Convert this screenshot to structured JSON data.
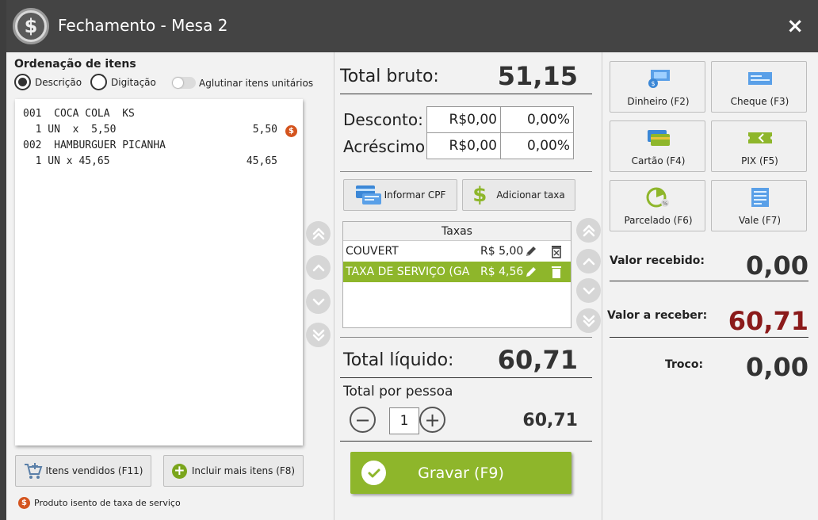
{
  "window": {
    "title": "Fechamento - Mesa 2",
    "close_label": "×",
    "icon": "dollar-coin-icon"
  },
  "ordering": {
    "title": "Ordenação de itens",
    "options": [
      {
        "label": "Descrição",
        "selected": true
      },
      {
        "label": "Digitação",
        "selected": false
      }
    ],
    "toggle_label": "Aglutinar itens unitários",
    "toggle_on": false
  },
  "receipt": {
    "items": [
      {
        "line1": "001  COCA COLA  KS",
        "line2": "  1 UN  x  5,50",
        "amount": "5,50",
        "exempt": true
      },
      {
        "line1": "002  HAMBURGUER PICANHA",
        "line2": "  1 UN x 45,65",
        "amount": "45,65",
        "exempt": false
      }
    ],
    "exempt_glyph": "$"
  },
  "left_buttons": {
    "sold_items": "Itens vendidos (F11)",
    "include_more": "Incluir mais itens (F8)"
  },
  "legend": {
    "text": "Produto isento de taxa de serviço"
  },
  "totals": {
    "gross_label": "Total bruto:",
    "gross_value": "51,15",
    "discount_label": "Desconto:",
    "discount_amount": "R$0,00",
    "discount_percent": "0,00%",
    "addition_label": "Acréscimo:",
    "addition_amount": "R$0,00",
    "addition_percent": "0,00%",
    "net_label": "Total líquido:",
    "net_value": "60,71",
    "per_person_label": "Total por pessoa",
    "people": "1",
    "per_person_value": "60,71"
  },
  "actions": {
    "cpf": "Informar CPF",
    "add_fee": "Adicionar taxa",
    "save": "Gravar (F9)"
  },
  "fees": {
    "header": "Taxas",
    "rows": [
      {
        "name": "COUVERT",
        "value": "R$ 5,00",
        "selected": false
      },
      {
        "name": "TAXA DE SERVIÇO (GA",
        "value": "R$ 4,56",
        "selected": true
      }
    ]
  },
  "payments": [
    {
      "label": "Dinheiro (F2)",
      "icon": "cash-icon"
    },
    {
      "label": "Cheque (F3)",
      "icon": "check-icon"
    },
    {
      "label": "Cartão (F4)",
      "icon": "card-icon"
    },
    {
      "label": "PIX (F5)",
      "icon": "pix-icon"
    },
    {
      "label": "Parcelado (F6)",
      "icon": "installments-icon"
    },
    {
      "label": "Vale (F7)",
      "icon": "voucher-icon"
    }
  ],
  "summary": {
    "received_label": "Valor recebido:",
    "received_value": "0,00",
    "to_receive_label": "Valor a receber:",
    "to_receive_value": "60,71",
    "change_label": "Troco:",
    "change_value": "0,00"
  },
  "colors": {
    "accent_green": "#8eb62b",
    "due_red": "#8b1a1a",
    "titlebar": "#444444",
    "exempt_orange": "#d4541e"
  }
}
